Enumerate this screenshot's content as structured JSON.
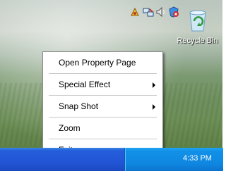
{
  "desktop": {
    "icons": [
      {
        "label": "Recycle Bin",
        "icon": "recycle-bin-icon"
      }
    ]
  },
  "context_menu": {
    "items": [
      {
        "label": "Open Property Page",
        "has_submenu": false
      },
      {
        "label": "Special Effect",
        "has_submenu": true
      },
      {
        "label": "Snap Shot",
        "has_submenu": true
      },
      {
        "label": "Zoom",
        "has_submenu": false
      },
      {
        "label": "Exit",
        "has_submenu": false
      }
    ]
  },
  "taskbar": {
    "tray_icons": [
      "app-tray-icon",
      "network-icon",
      "speaker-icon",
      "security-alert-icon"
    ],
    "clock": "4:33 PM"
  },
  "colors": {
    "taskbar_blue": "#245edb",
    "tray_blue": "#0f87e0",
    "menu_bg": "#ffffff"
  }
}
